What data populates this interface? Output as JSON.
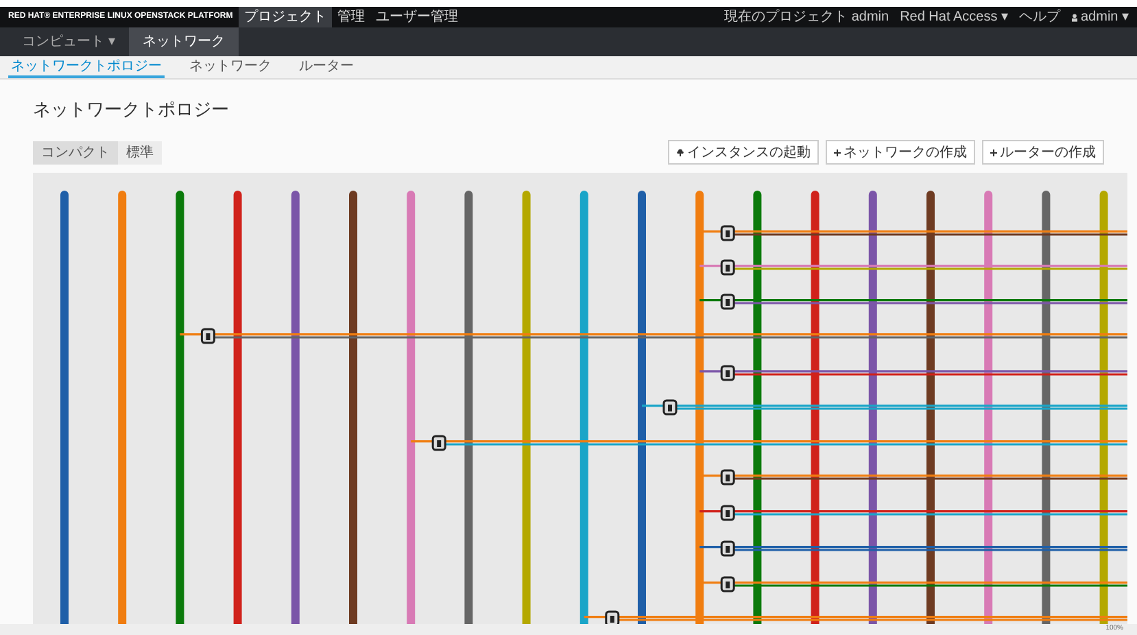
{
  "brand": "RED HAT® ENTERPRISE LINUX OPENSTACK PLATFORM",
  "top_nav": [
    {
      "label": "プロジェクト",
      "selected": true
    },
    {
      "label": "管理",
      "selected": false
    },
    {
      "label": "ユーザー管理",
      "selected": false
    }
  ],
  "top_right": {
    "project": "現在のプロジェクト admin",
    "access": "Red Hat Access ▾",
    "help": "ヘルプ",
    "user": "admin ▾"
  },
  "section_tabs": [
    {
      "label": "コンピュート ▾",
      "selected": false
    },
    {
      "label": "ネットワーク",
      "selected": true
    }
  ],
  "sub_tabs": [
    {
      "label": "ネットワークトポロジー",
      "selected": true
    },
    {
      "label": "ネットワーク",
      "selected": false
    },
    {
      "label": "ルーター",
      "selected": false
    }
  ],
  "page_title": "ネットワークトポロジー",
  "view_toggle": [
    {
      "label": "コンパクト",
      "selected": true
    },
    {
      "label": "標準",
      "selected": false
    }
  ],
  "actions": [
    "インスタンスの起動",
    "ネットワークの作成",
    "ルーターの作成"
  ],
  "zoom_indicator": "100%"
}
